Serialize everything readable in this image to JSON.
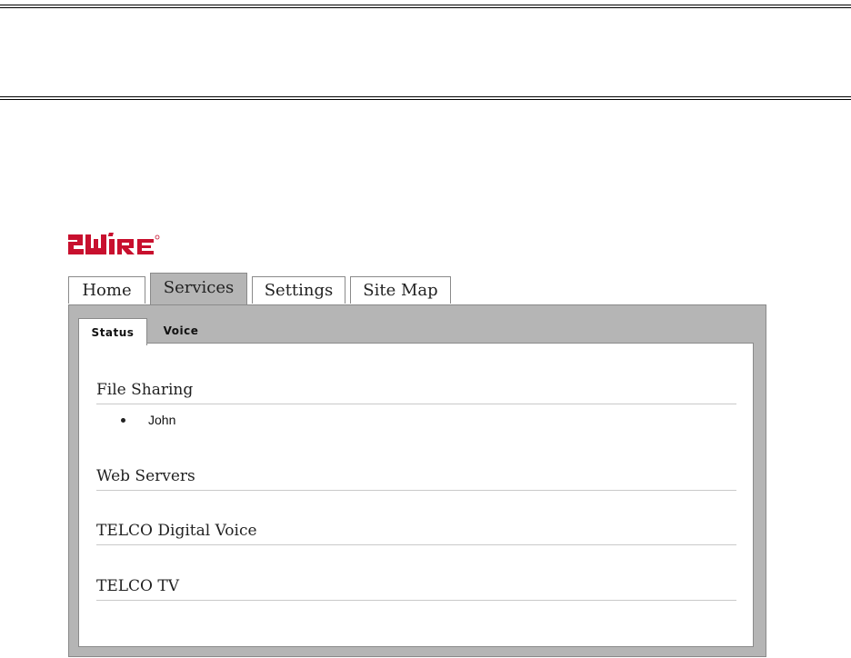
{
  "brand": {
    "name": "2WIRE",
    "color": "#c8102e"
  },
  "nav": {
    "tabs": [
      {
        "label": "Home",
        "active": false
      },
      {
        "label": "Services",
        "active": true
      },
      {
        "label": "Settings",
        "active": false
      },
      {
        "label": "Site Map",
        "active": false
      }
    ]
  },
  "subnav": {
    "tabs": [
      {
        "label": "Status",
        "active": true
      },
      {
        "label": "Voice",
        "active": false
      }
    ]
  },
  "sections": [
    {
      "title": "File Sharing",
      "items": [
        "John"
      ]
    },
    {
      "title": "Web Servers",
      "items": []
    },
    {
      "title": "TELCO Digital Voice",
      "items": []
    },
    {
      "title": "TELCO TV",
      "items": []
    }
  ]
}
